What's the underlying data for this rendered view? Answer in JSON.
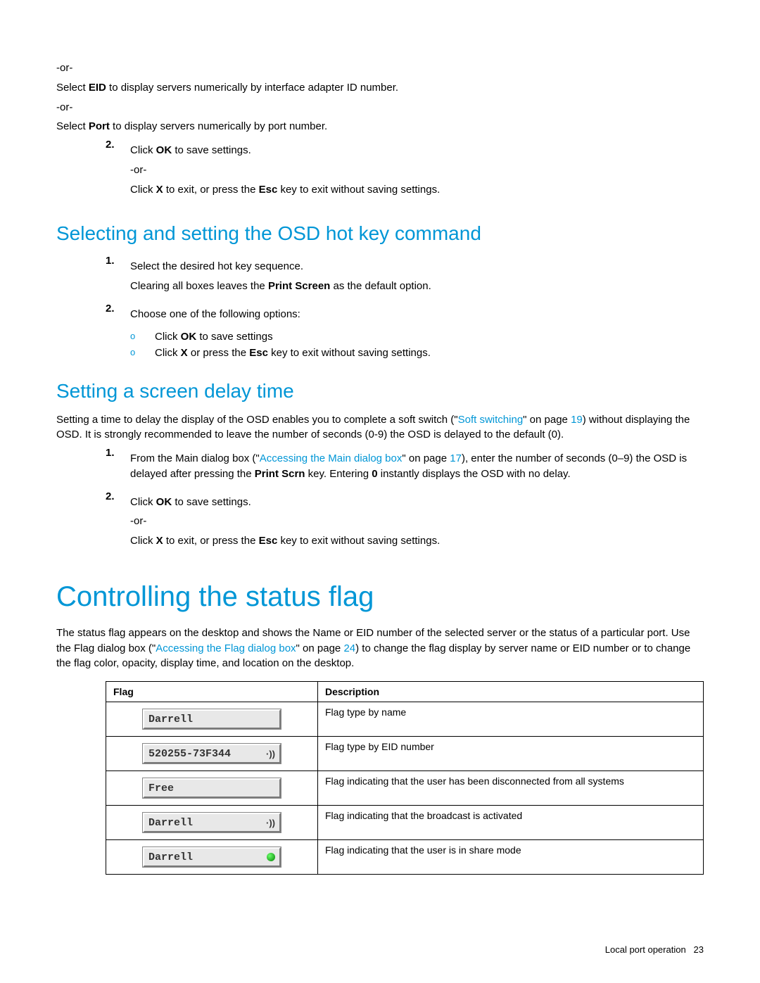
{
  "top_block": {
    "or1": "-or-",
    "line1a": "Select ",
    "line1b": "EID",
    "line1c": " to display servers numerically by interface adapter ID number.",
    "or2": "-or-",
    "line2a": "Select ",
    "line2b": "Port",
    "line2c": " to display servers numerically by port number.",
    "num2": "2.",
    "step2a": "Click ",
    "step2b": "OK",
    "step2c": " to save settings.",
    "or3": "-or-",
    "step2d": "Click ",
    "step2e": "X",
    "step2f": " to exit, or press the ",
    "step2g": "Esc",
    "step2h": " key to exit without saving settings."
  },
  "hotkey": {
    "heading": "Selecting and setting the OSD hot key command",
    "num1": "1.",
    "s1": "Select the desired hot key sequence.",
    "s1b_a": "Clearing all boxes leaves the ",
    "s1b_b": "Print Screen",
    "s1b_c": " as the default option.",
    "num2": "2.",
    "s2": "Choose one of the following options:",
    "sub_mark": "o",
    "sub1a": "Click ",
    "sub1b": "OK",
    "sub1c": " to save settings",
    "sub2a": "Click ",
    "sub2b": "X",
    "sub2c": " or press the ",
    "sub2d": "Esc",
    "sub2e": " key to exit without saving settings."
  },
  "delay": {
    "heading": "Setting a screen delay time",
    "p1a": "Setting a time to delay the display of the OSD enables you to complete a soft switch (\"",
    "p1link": "Soft switching",
    "p1b": "\" on page ",
    "p1page": "19",
    "p1c": ") without displaying the OSD. It is strongly recommended to leave the number of seconds (0-9) the OSD is delayed to the default (0).",
    "num1": "1.",
    "s1a": "From the Main dialog box (\"",
    "s1link": "Accessing the Main dialog box",
    "s1b": "\" on page ",
    "s1page": "17",
    "s1c": "), enter the number of seconds (0–9) the OSD is delayed after pressing the ",
    "s1d": "Print Scrn",
    "s1e": " key. Entering ",
    "s1f": "0",
    "s1g": " instantly displays the OSD with no delay.",
    "num2": "2.",
    "s2a": "Click ",
    "s2b": "OK",
    "s2c": " to save settings.",
    "or": "-or-",
    "s2d": "Click ",
    "s2e": "X",
    "s2f": " to exit, or press the ",
    "s2g": "Esc",
    "s2h": " key to exit without saving settings."
  },
  "status": {
    "heading": "Controlling the status flag",
    "p1a": "The status flag appears on the desktop and shows the Name or EID number of the selected server or the status of a particular port. Use the Flag dialog box (\"",
    "p1link": "Accessing the Flag dialog box",
    "p1b": "\" on page ",
    "p1page": "24",
    "p1c": ") to change the flag display by server name or EID number or to change the flag color, opacity, display time, and location on the desktop.",
    "th1": "Flag",
    "th2": "Description",
    "row1_flag": "Darrell",
    "row1_desc": "Flag type by name",
    "row2_flag": "520255-73F344",
    "row2_desc": "Flag type by EID number",
    "row3_flag": "Free",
    "row3_desc": "Flag indicating that the user has been disconnected from all systems",
    "row4_flag": "Darrell",
    "row4_desc": "Flag indicating that the broadcast is activated",
    "row5_flag": "Darrell",
    "row5_desc": "Flag indicating that the user is in share mode"
  },
  "footer": {
    "text": "Local port operation",
    "page": "23"
  }
}
